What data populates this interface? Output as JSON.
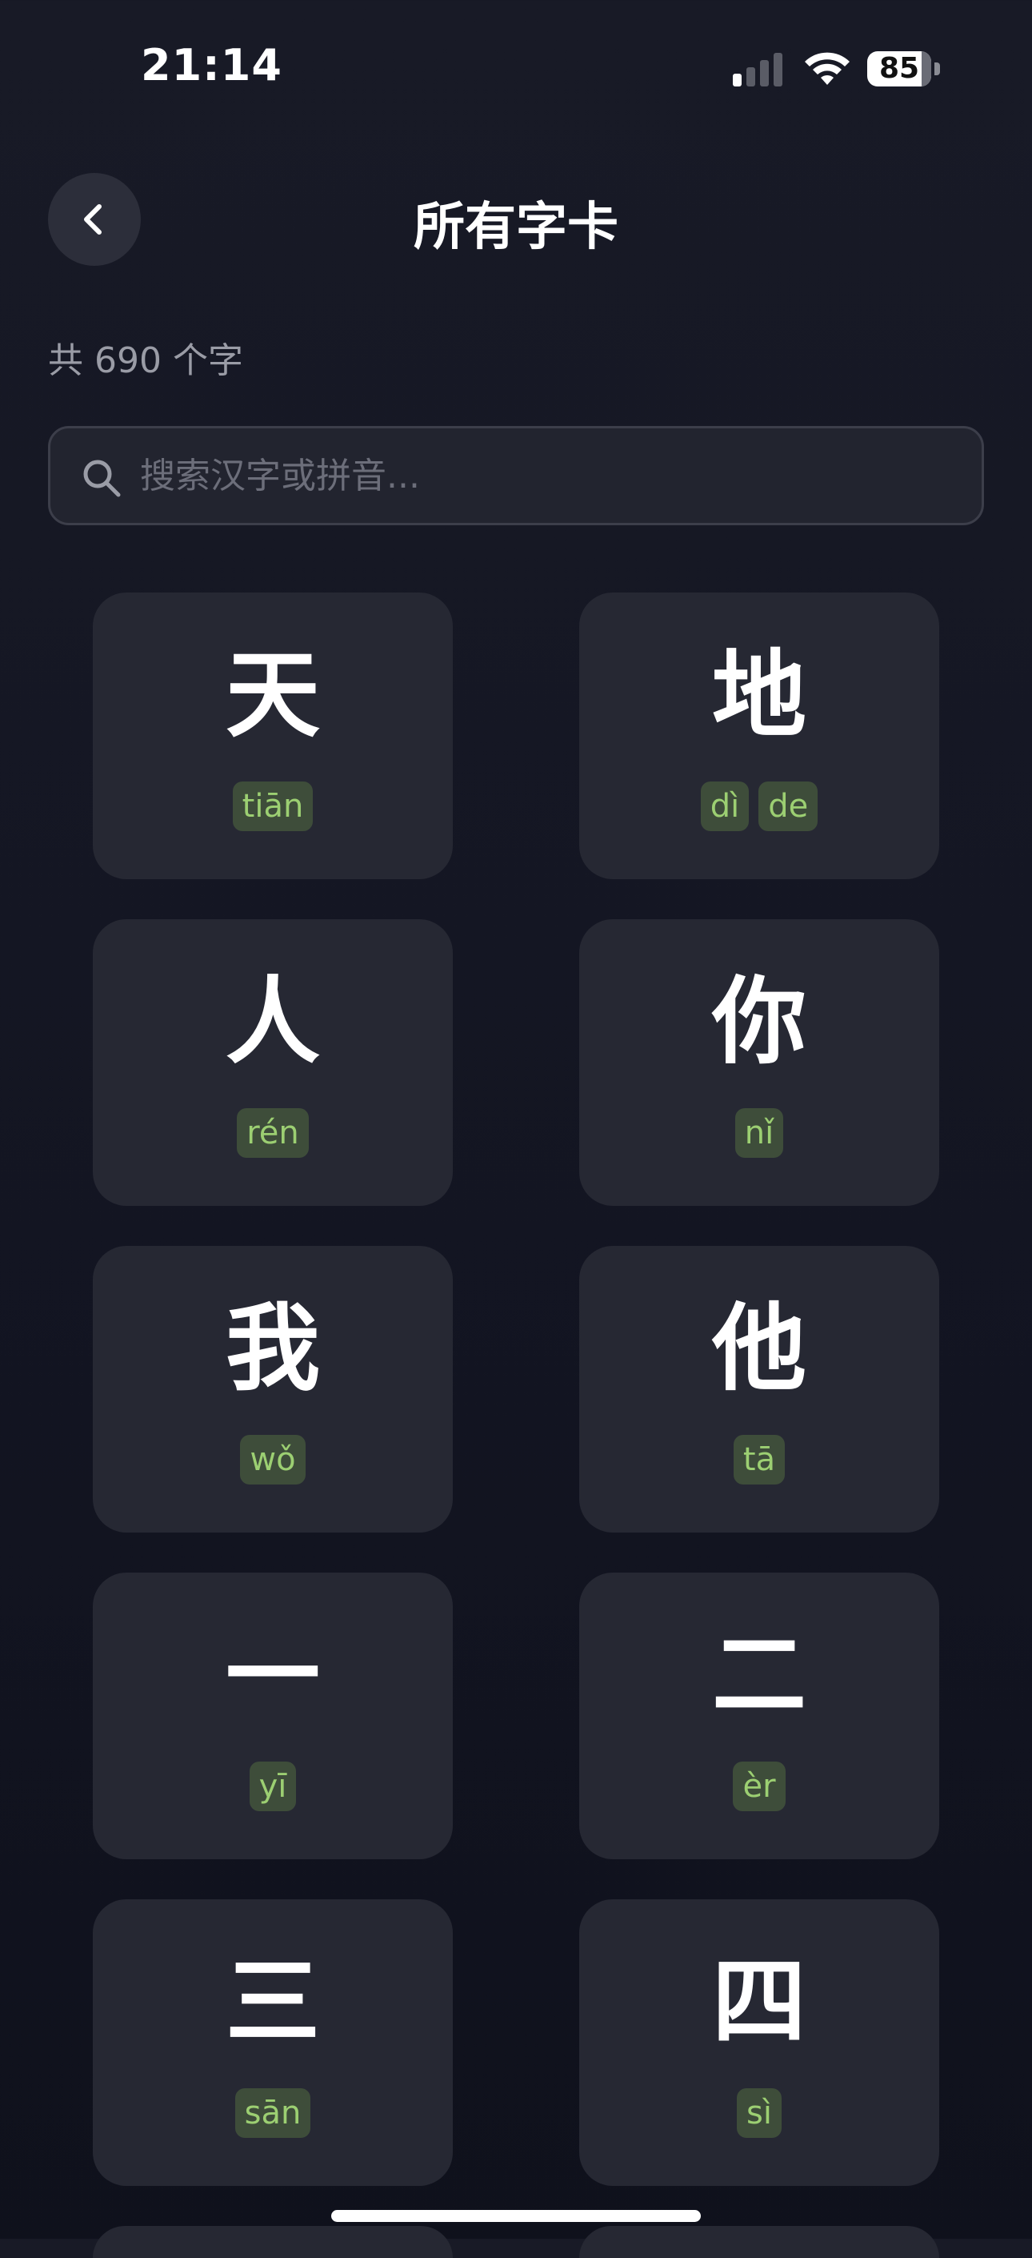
{
  "status_bar": {
    "time": "21:14",
    "battery_level": "85",
    "battery_fraction": 0.85,
    "signal_bars_active": 1,
    "signal_bars_total": 4
  },
  "header": {
    "title": "所有字卡",
    "back_icon": "chevron-left-icon"
  },
  "summary": {
    "count_text": "共 690 个字"
  },
  "search": {
    "icon": "search-icon",
    "placeholder": "搜索汉字或拼音...",
    "value": ""
  },
  "cards": [
    {
      "char": "天",
      "pinyin": [
        "tiān"
      ]
    },
    {
      "char": "地",
      "pinyin": [
        "dì",
        "de"
      ]
    },
    {
      "char": "人",
      "pinyin": [
        "rén"
      ]
    },
    {
      "char": "你",
      "pinyin": [
        "nǐ"
      ]
    },
    {
      "char": "我",
      "pinyin": [
        "wǒ"
      ]
    },
    {
      "char": "他",
      "pinyin": [
        "tā"
      ]
    },
    {
      "char": "一",
      "pinyin": [
        "yī"
      ]
    },
    {
      "char": "二",
      "pinyin": [
        "èr"
      ]
    },
    {
      "char": "三",
      "pinyin": [
        "sān"
      ]
    },
    {
      "char": "四",
      "pinyin": [
        "sì"
      ]
    }
  ],
  "colors": {
    "background": "#141623",
    "card": "#262833",
    "pinyin_badge_bg": "#3e4d3a",
    "pinyin_text": "#9ccf72",
    "muted_text": "#9a9ca6"
  }
}
